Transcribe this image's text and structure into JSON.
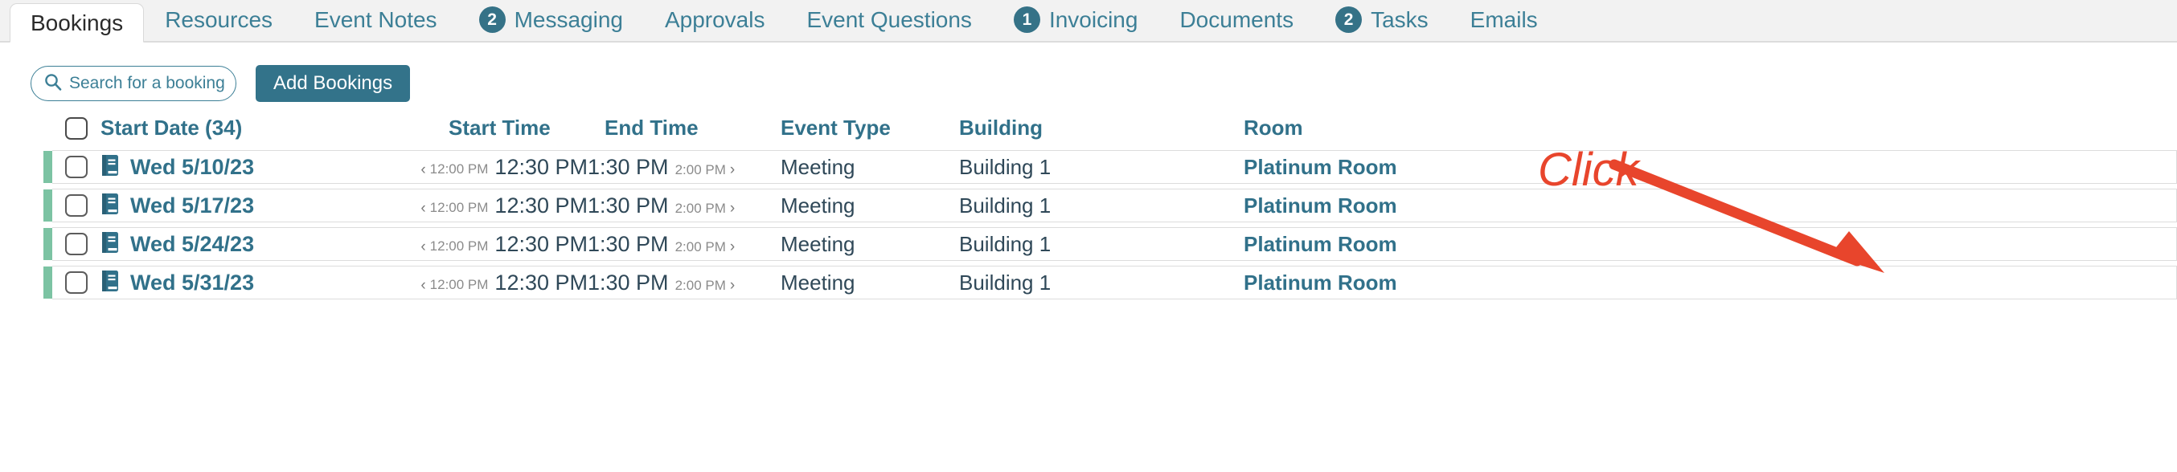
{
  "tabs": [
    {
      "label": "Bookings",
      "badge": null,
      "active": true
    },
    {
      "label": "Resources",
      "badge": null,
      "active": false
    },
    {
      "label": "Event Notes",
      "badge": null,
      "active": false
    },
    {
      "label": "Messaging",
      "badge": "2",
      "active": false
    },
    {
      "label": "Approvals",
      "badge": null,
      "active": false
    },
    {
      "label": "Event Questions",
      "badge": null,
      "active": false
    },
    {
      "label": "Invoicing",
      "badge": "1",
      "active": false
    },
    {
      "label": "Documents",
      "badge": null,
      "active": false
    },
    {
      "label": "Tasks",
      "badge": "2",
      "active": false
    },
    {
      "label": "Emails",
      "badge": null,
      "active": false
    }
  ],
  "toolbar": {
    "search_placeholder": "Search for a booking",
    "search_value": "",
    "add_label": "Add Bookings"
  },
  "table": {
    "headers": {
      "start_date": "Start Date (34)",
      "start_time": "Start Time",
      "end_time": "End Time",
      "event_type": "Event Type",
      "building": "Building",
      "room": "Room"
    },
    "rows": [
      {
        "date": "Wed 5/10/23",
        "setup_time": "12:00 PM",
        "start_time": "12:30 PM",
        "end_time": "1:30 PM",
        "teardown_time": "2:00 PM",
        "event_type": "Meeting",
        "building": "Building 1",
        "room": "Platinum Room"
      },
      {
        "date": "Wed 5/17/23",
        "setup_time": "12:00 PM",
        "start_time": "12:30 PM",
        "end_time": "1:30 PM",
        "teardown_time": "2:00 PM",
        "event_type": "Meeting",
        "building": "Building 1",
        "room": "Platinum Room"
      },
      {
        "date": "Wed 5/24/23",
        "setup_time": "12:00 PM",
        "start_time": "12:30 PM",
        "end_time": "1:30 PM",
        "teardown_time": "2:00 PM",
        "event_type": "Meeting",
        "building": "Building 1",
        "room": "Platinum Room"
      },
      {
        "date": "Wed 5/31/23",
        "setup_time": "12:00 PM",
        "start_time": "12:30 PM",
        "end_time": "1:30 PM",
        "teardown_time": "2:00 PM",
        "event_type": "Meeting",
        "building": "Building 1",
        "room": "Platinum Room"
      }
    ]
  },
  "annotation": {
    "label": "Click",
    "color": "#e8452c"
  },
  "colors": {
    "teal": "#31718a",
    "tab_bar": "#f2f2f2",
    "row_accent": "#7cc3a3",
    "text_dark": "#2f4858"
  }
}
